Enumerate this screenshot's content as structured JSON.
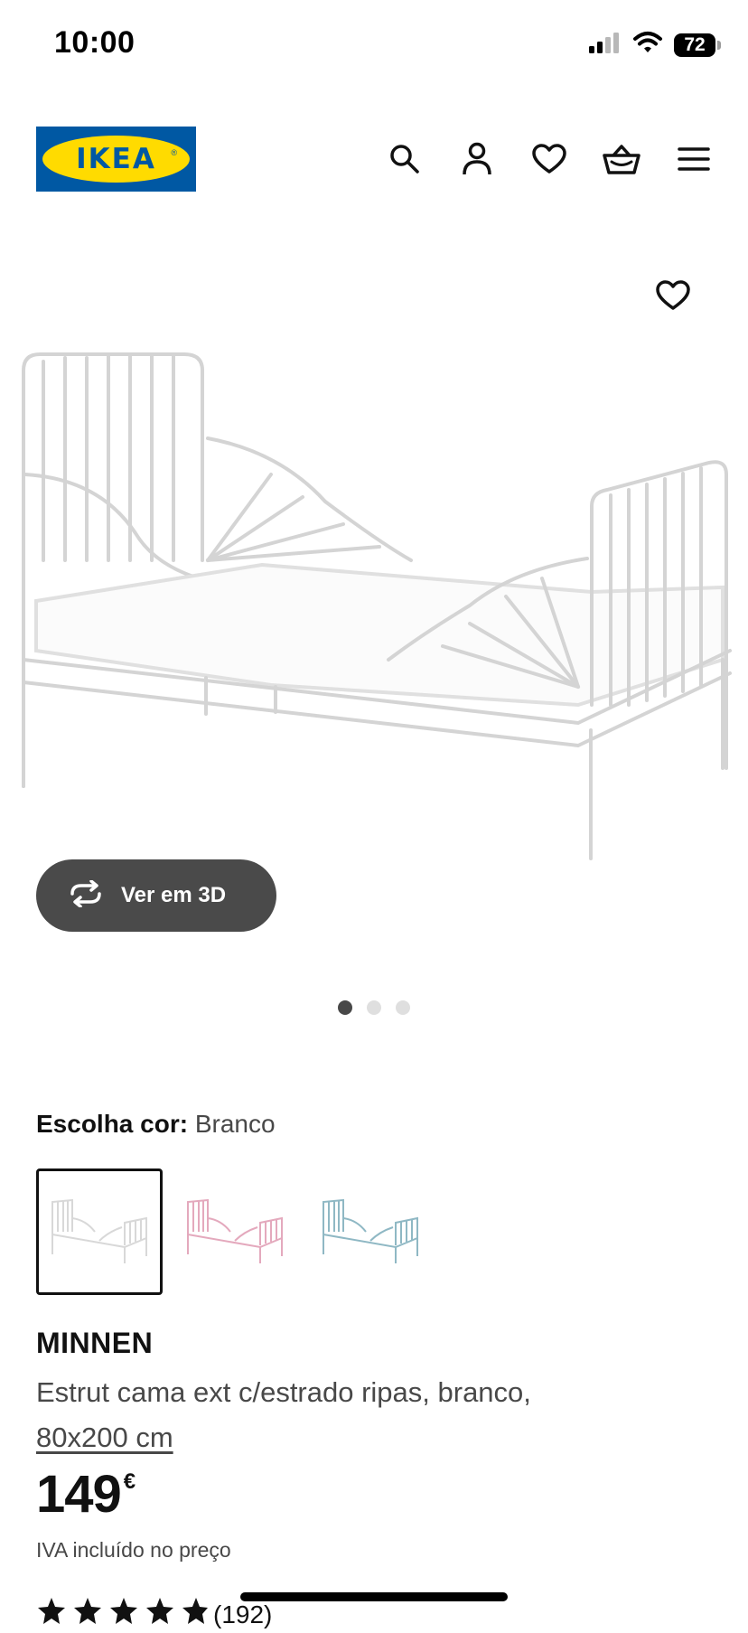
{
  "status_bar": {
    "time": "10:00",
    "battery": "72",
    "icons": [
      "signal-icon",
      "wifi-icon",
      "battery-icon"
    ]
  },
  "header": {
    "logo_text": "IKEA",
    "icons": [
      "search-icon",
      "account-icon",
      "heart-icon",
      "basket-icon",
      "menu-icon"
    ]
  },
  "gallery": {
    "view_3d_label": "Ver em 3D",
    "image_count": 3,
    "active_index": 0
  },
  "color_selector": {
    "label": "Escolha cor:",
    "selected_value": "Branco",
    "swatches": [
      "white",
      "pink",
      "turquoise"
    ]
  },
  "product": {
    "name": "MINNEN",
    "description": "Estrut cama ext c/estrado ripas, branco,",
    "size": "80x200 cm",
    "price": "149",
    "currency": "€",
    "vat_note": "IVA incluído no preço",
    "rating_stars": 5,
    "review_count": "(192)"
  },
  "colors": {
    "ikea_blue": "#0058a3",
    "ikea_yellow": "#ffdb00",
    "button_dark": "#4a4a4a"
  }
}
